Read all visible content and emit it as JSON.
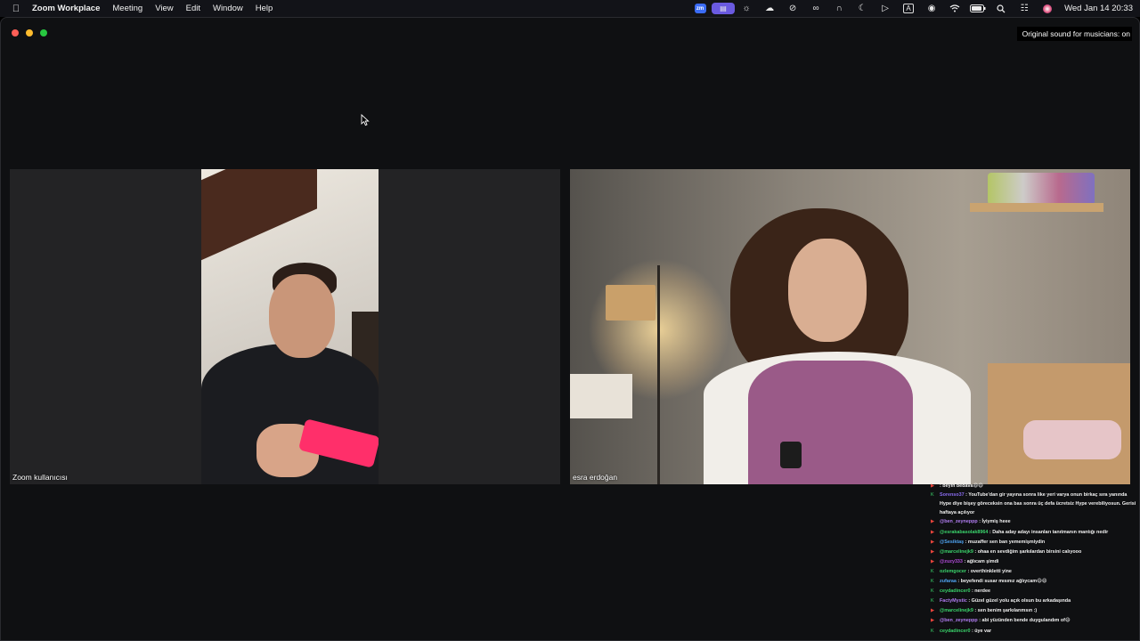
{
  "menubar": {
    "apple_icon": "apple-icon",
    "app_name": "Zoom Workplace",
    "menus": [
      "Meeting",
      "View",
      "Edit",
      "Window",
      "Help"
    ],
    "status_icons": [
      "zoom-icon",
      "screen-share-icon",
      "wave-icon",
      "cloud-icon",
      "compass-icon",
      "creative-cloud-icon",
      "airpods-icon",
      "moon-icon",
      "play-icon",
      "text-input-icon",
      "user-icon",
      "wifi-icon",
      "battery-icon",
      "search-icon",
      "control-center-icon",
      "siri-icon"
    ],
    "datetime": "Wed Jan 14  20:33"
  },
  "window": {
    "original_sound": "Original sound for musicians: on"
  },
  "participants": [
    {
      "name": "Zoom kullanıcısı"
    },
    {
      "name": "esra erdoğan"
    }
  ],
  "chat": {
    "messages": [
      {
        "badge": "red",
        "user": "",
        "text": ": beyin bedava😄😄",
        "user_color": "#e8443c"
      },
      {
        "badge": "green",
        "user": "Sorenso37",
        "text": ": YouTube'dan gir yayına sonra like yeri varya onun birkaç sıra yanında Hype diye bişey göreceksin ona bas sonra üç defa ücretsiz Hype verebiliyosun. Gerisi haftaya açılıyor",
        "user_color": "#8a6cf0",
        "wrap": true
      },
      {
        "badge": "red",
        "user": "@ben_zeyneppp",
        "text": ": İyiymiş heee",
        "user_color": "#b07cf0"
      },
      {
        "badge": "red",
        "user": "@esrakabasolak8964",
        "text": ": Daha aday adayı insanları tanıtmanın mantığı nedir",
        "user_color": "#3ad36b"
      },
      {
        "badge": "red",
        "user": "@Sesiktaş",
        "text": ": muzaffer sen ban yememişmiydin",
        "user_color": "#4ea3f0"
      },
      {
        "badge": "red",
        "user": "@marcelinejk9",
        "text": ": ohaa en sevdiğim şarkılardan birsini calıyooo",
        "user_color": "#3ad36b"
      },
      {
        "badge": "red",
        "user": "@zuzy333",
        "text": ": ağlıcam şimdi",
        "user_color": "#b04ad8"
      },
      {
        "badge": "green",
        "user": "ozlemgocer",
        "text": ": overthinkletti yine",
        "user_color": "#3ad36b"
      },
      {
        "badge": "green",
        "user": "zufaraa",
        "text": ": beyefendi susar mısınız ağlıycam😄😄",
        "user_color": "#4ea3f0"
      },
      {
        "badge": "green",
        "user": "ceydadincer0",
        "text": ": nerdee",
        "user_color": "#3ad36b"
      },
      {
        "badge": "green",
        "user": "FactyMystic",
        "text": ": Güzel güzel yolu açık olsun bu arkadaşında",
        "user_color": "#b07cf0"
      },
      {
        "badge": "red",
        "user": "@marcelinejk9",
        "text": ": sen benim şarkılarımsın :)",
        "user_color": "#3ad36b"
      },
      {
        "badge": "red",
        "user": "@ben_zeyneppp",
        "text": ": abi yüzünden bende duygulandım of😄",
        "user_color": "#b07cf0"
      },
      {
        "badge": "green",
        "user": "ceydadincer0",
        "text": ": üye var",
        "user_color": "#3ad36b"
      }
    ]
  }
}
